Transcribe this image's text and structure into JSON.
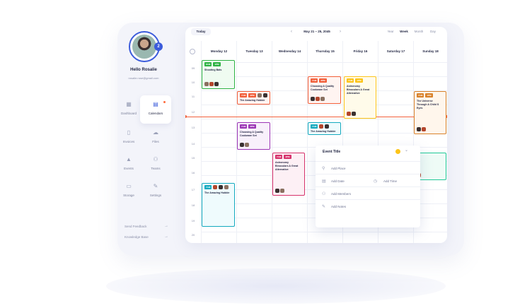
{
  "profile": {
    "greeting": "Hello Rosalie",
    "email": "rosalie.rose@gmail.com",
    "badge": "2"
  },
  "sidebar": {
    "tiles": [
      {
        "label": "Dashboard",
        "icon": "dashboard-icon",
        "glyph": "▦"
      },
      {
        "label": "Calendars",
        "icon": "calendar-icon",
        "glyph": "▤"
      },
      {
        "label": "Invoices",
        "icon": "invoice-icon",
        "glyph": "▯"
      },
      {
        "label": "Files",
        "icon": "cloud-icon",
        "glyph": "☁"
      },
      {
        "label": "Events",
        "icon": "mountain-icon",
        "glyph": "▲"
      },
      {
        "label": "Teams",
        "icon": "team-icon",
        "glyph": "⚇"
      },
      {
        "label": "Storage",
        "icon": "chat-icon",
        "glyph": "▭"
      },
      {
        "label": "Settings",
        "icon": "wrench-icon",
        "glyph": "✎"
      }
    ],
    "links": [
      {
        "label": "Send Feedback",
        "arrow": "→"
      },
      {
        "label": "Knowledge Base",
        "arrow": "→"
      }
    ]
  },
  "toolbar": {
    "today": "Today",
    "prev": "‹",
    "next": "›",
    "range": "May 21 – 25, 2045",
    "views": [
      "Year",
      "Week",
      "Month",
      "Day"
    ],
    "active_view": "Week"
  },
  "days": [
    "Monday 12",
    "Tuesday 13",
    "Wednesday 14",
    "Thursday 15",
    "Friday 16",
    "Saturday 17",
    "Sunday 18"
  ],
  "hours": [
    "09",
    "10",
    "11",
    "12",
    "13",
    "14",
    "15",
    "16",
    "17",
    "18",
    "19",
    "20"
  ],
  "events": [
    {
      "title": "Shooting Bats",
      "tags": [
        "8AM",
        "1PM"
      ],
      "colors": {
        "border": "#2fb344",
        "bg": "#effbf1",
        "tag": "#2fb344"
      }
    },
    {
      "title": "The Amazing Hubble",
      "tags": [
        "7AM",
        "3PM"
      ],
      "colors": {
        "border": "#f25f3a",
        "bg": "#fff4f1",
        "tag": "#f25f3a"
      }
    },
    {
      "title": "Choosing A Quality Cookware Set",
      "tags": [
        "7AM",
        "3PM"
      ],
      "colors": {
        "border": "#f25f3a",
        "bg": "#fff4f1",
        "tag": "#f25f3a"
      }
    },
    {
      "title": "Astronomy Binoculars A Great Alternative",
      "tags": [
        "7AM",
        "1PM"
      ],
      "colors": {
        "border": "#fcc419",
        "bg": "#fffbea",
        "tag": "#fcc419"
      }
    },
    {
      "title": "The Universe Through A Child S Eyes",
      "tags": [
        "7AM",
        "1PM"
      ],
      "colors": {
        "border": "#d9822b",
        "bg": "#fff6ec",
        "tag": "#d9822b"
      }
    },
    {
      "title": "Choosing A Quality Cookware Set",
      "tags": [
        "7AM",
        "3PM"
      ],
      "colors": {
        "border": "#9c36b5",
        "bg": "#f8f0fb",
        "tag": "#9c36b5"
      }
    },
    {
      "title": "The Amazing Hubble",
      "tags": [
        "7AM"
      ],
      "colors": {
        "border": "#15aabf",
        "bg": "#effbfd",
        "tag": "#15aabf"
      }
    },
    {
      "title": "Astronomy Binoculars A Great Alternative",
      "tags": [
        "7AM",
        "3PM"
      ],
      "colors": {
        "border": "#d6336c",
        "bg": "#fdf0f5",
        "tag": "#d6336c"
      }
    },
    {
      "title": "The Amazing Hubble",
      "tags": [
        "7AM"
      ],
      "colors": {
        "border": "#15aabf",
        "bg": "#effbfd",
        "tag": "#15aabf"
      }
    },
    {
      "title": "",
      "tags": [],
      "colors": {
        "border": "#20c997",
        "bg": "#eefbf6",
        "tag": "#20c997"
      }
    }
  ],
  "popup": {
    "title": "Event Title",
    "color": "#fcc419",
    "caret": "⌄",
    "add_place": "Add Place",
    "add_date": "Add Date",
    "add_time": "Add Time",
    "add_members": "Add Members",
    "add_notes": "Add Notes"
  },
  "colors": {
    "accent": "#3b5bdb",
    "now_line": "#f25f3a"
  }
}
